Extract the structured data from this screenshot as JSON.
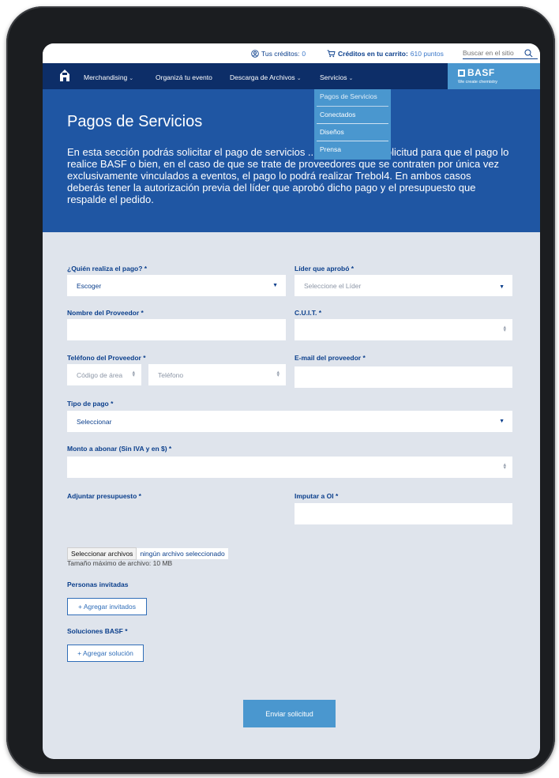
{
  "utility": {
    "credits_label": "Tus créditos:",
    "credits_value": "0",
    "cart_label": "Créditos en tu carrito:",
    "cart_value": "610 puntos",
    "search_placeholder": "Buscar en el sitio"
  },
  "nav": {
    "items": [
      {
        "label": "Merchandising",
        "has_menu": true
      },
      {
        "label": "Organizá tu evento",
        "has_menu": false
      },
      {
        "label": "Descarga de Archivos",
        "has_menu": true
      },
      {
        "label": "Servicios",
        "has_menu": true
      }
    ],
    "chevron": "⌄",
    "brand_name": "BASF",
    "brand_tagline": "We create chemistry"
  },
  "dropdown": {
    "items": [
      "Pagos de Servicios",
      "Conectados",
      "Diseños",
      "Prensa"
    ]
  },
  "hero": {
    "title": "Pagos de Servicios",
    "body": "En esta sección podrás solicitar el pago de servicios ... de realizar la solicitud para que el pago lo realice BASF o bien, en el caso de que se trate de proveedores que se contraten por única vez exclusivamente vinculados a eventos, el pago lo podrá realizar Trebol4. En ambos casos deberás tener la autorización previa del líder que aprobó dicho pago y el presupuesto que respalde el pedido."
  },
  "form": {
    "payer_label": "¿Quién realiza el pago? *",
    "payer_value": "Escoger",
    "leader_label": "Líder que aprobó *",
    "leader_placeholder": "Seleccione el Líder",
    "supplier_label": "Nombre del Proveedor *",
    "cuit_label": "C.U.I.T. *",
    "phone_label": "Teléfono del Proveedor *",
    "area_placeholder": "Código de área",
    "phone_placeholder": "Teléfono",
    "email_label": "E-mail del proveedor *",
    "payment_type_label": "Tipo de pago *",
    "payment_type_value": "Seleccionar",
    "amount_label": "Monto a abonar (Sin IVA y en $) *",
    "budget_label": "Adjuntar presupuesto *",
    "oi_label": "Imputar a OI *",
    "file_button": "Seleccionar archivos",
    "file_status": "ningún archivo seleccionado",
    "file_hint": "Tamaño máximo de archivo: 10 MB",
    "guests_label": "Personas invitadas",
    "guests_button": "+ Agregar invitados",
    "solutions_label": "Soluciones BASF *",
    "solutions_button": "+ Agregar solución",
    "submit": "Enviar solicitud"
  }
}
